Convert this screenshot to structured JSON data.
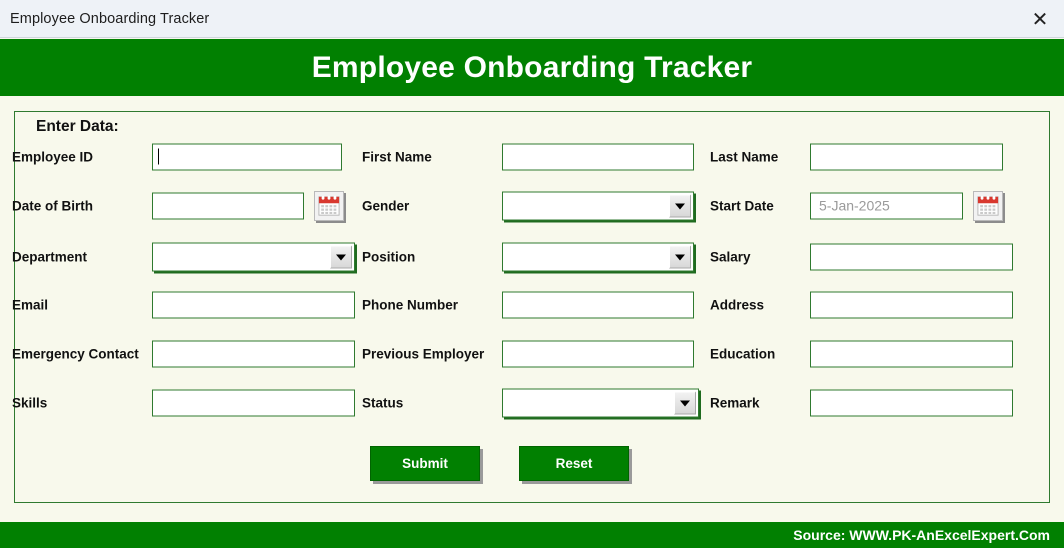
{
  "titlebar": {
    "title": "Employee Onboarding Tracker",
    "close_icon": "close-icon",
    "close_glyph": "✕"
  },
  "banner": {
    "title": "Employee Onboarding Tracker",
    "bg_color": "#018001",
    "text_color": "#FFFFFF"
  },
  "groupbox": {
    "legend": "Enter Data:"
  },
  "form": {
    "rows": [
      {
        "left": {
          "label": "Employee ID",
          "type": "text",
          "value": ""
        },
        "mid": {
          "label": "First Name",
          "type": "text",
          "value": ""
        },
        "right": {
          "label": "Last Name",
          "type": "text",
          "value": ""
        }
      },
      {
        "left": {
          "label": "Date of Birth",
          "type": "date",
          "value": ""
        },
        "mid": {
          "label": "Gender",
          "type": "combo",
          "value": ""
        },
        "right": {
          "label": "Start Date",
          "type": "date",
          "value": "",
          "placeholder": "5-Jan-2025"
        }
      },
      {
        "left": {
          "label": "Department",
          "type": "combo",
          "value": ""
        },
        "mid": {
          "label": "Position",
          "type": "combo",
          "value": ""
        },
        "right": {
          "label": "Salary",
          "type": "text",
          "value": ""
        }
      },
      {
        "left": {
          "label": "Email",
          "type": "text",
          "value": ""
        },
        "mid": {
          "label": "Phone Number",
          "type": "text",
          "value": ""
        },
        "right": {
          "label": "Address",
          "type": "text",
          "value": ""
        }
      },
      {
        "left": {
          "label": "Emergency Contact",
          "type": "text",
          "value": ""
        },
        "mid": {
          "label": "Previous Employer",
          "type": "text",
          "value": ""
        },
        "right": {
          "label": "Education",
          "type": "text",
          "value": ""
        }
      },
      {
        "left": {
          "label": "Skills",
          "type": "text",
          "value": ""
        },
        "mid": {
          "label": "Status",
          "type": "combo",
          "value": ""
        },
        "right": {
          "label": "Remark",
          "type": "text",
          "value": ""
        }
      }
    ]
  },
  "buttons": {
    "submit": "Submit",
    "reset": "Reset"
  },
  "footer": {
    "text": "Source: WWW.PK-AnExcelExpert.Com"
  },
  "icons": {
    "calendar": "calendar-icon",
    "dropdown": "chevron-down-icon"
  }
}
